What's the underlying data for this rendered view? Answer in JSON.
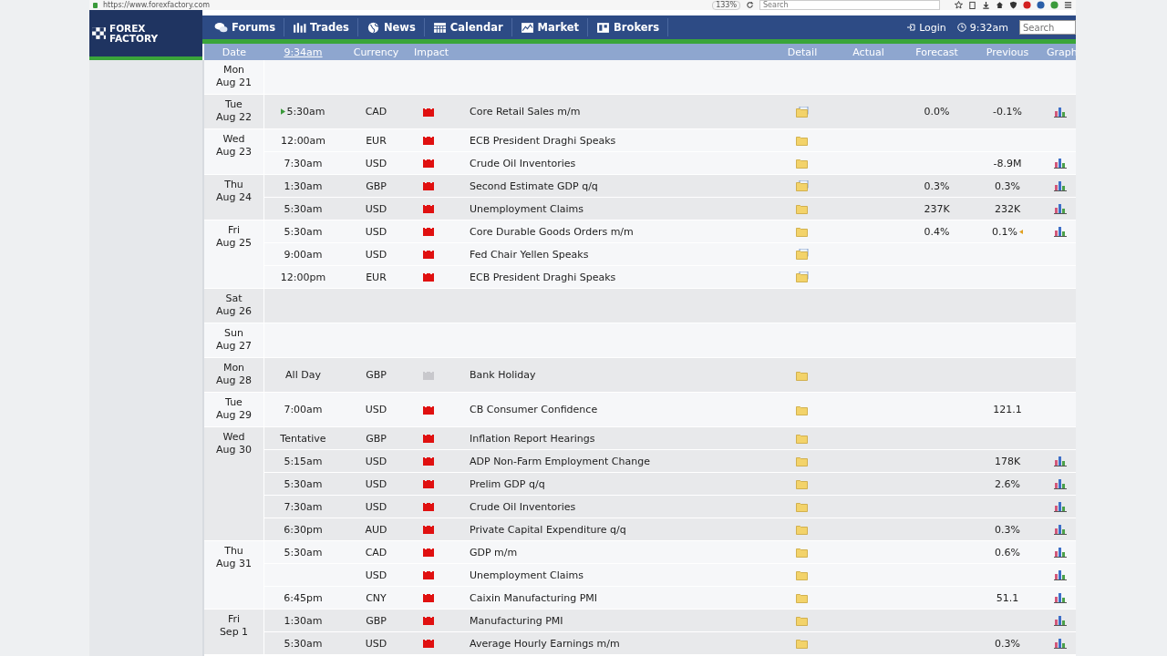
{
  "browser": {
    "url": "https://www.forexfactory.com",
    "zoom": "133%",
    "search_placeholder": "Search"
  },
  "site": {
    "logo": [
      "FOREX",
      "FACTORY"
    ],
    "nav": [
      {
        "label": "Forums",
        "kind": "chat"
      },
      {
        "label": "Trades",
        "kind": "bars"
      },
      {
        "label": "News",
        "kind": "globe"
      },
      {
        "label": "Calendar",
        "kind": "calendar"
      },
      {
        "label": "Market",
        "kind": "chart"
      },
      {
        "label": "Brokers",
        "kind": "building"
      }
    ],
    "login": "Login",
    "time": "9:32am",
    "search_placeholder": "Search"
  },
  "columns": {
    "date": "Date",
    "time": "9:34am",
    "currency": "Currency",
    "impact": "Impact",
    "detail": "Detail",
    "actual": "Actual",
    "forecast": "Forecast",
    "previous": "Previous",
    "graph": "Graph"
  },
  "days": [
    {
      "day": "Mon",
      "date": "Aug 21"
    },
    {
      "day": "Tue",
      "date": "Aug 22",
      "events": [
        {
          "time": "5:30am",
          "next": true,
          "currency": "CAD",
          "color": "#e01010",
          "title": "Core Retail Sales m/m",
          "has_document": true,
          "forecast": "0.0%",
          "previous": "-0.1%",
          "revised": false,
          "graph": true
        }
      ]
    },
    {
      "day": "Wed",
      "date": "Aug 23",
      "events": [
        {
          "time": "12:00am",
          "next": false,
          "currency": "EUR",
          "color": "#e01010",
          "title": "ECB President Draghi Speaks",
          "has_document": false,
          "revised": false,
          "graph": false
        },
        {
          "time": "7:30am",
          "next": false,
          "currency": "USD",
          "color": "#e01010",
          "title": "Crude Oil Inventories",
          "has_document": false,
          "previous": "-8.9M",
          "revised": false,
          "graph": true
        }
      ]
    },
    {
      "day": "Thu",
      "date": "Aug 24",
      "events": [
        {
          "time": "1:30am",
          "next": false,
          "currency": "GBP",
          "color": "#e01010",
          "title": "Second Estimate GDP q/q",
          "has_document": true,
          "forecast": "0.3%",
          "previous": "0.3%",
          "revised": false,
          "graph": true
        },
        {
          "time": "5:30am",
          "next": false,
          "currency": "USD",
          "color": "#e01010",
          "title": "Unemployment Claims",
          "has_document": false,
          "forecast": "237K",
          "previous": "232K",
          "revised": false,
          "graph": true
        }
      ]
    },
    {
      "day": "Fri",
      "date": "Aug 25",
      "events": [
        {
          "time": "5:30am",
          "next": false,
          "currency": "USD",
          "color": "#e01010",
          "title": "Core Durable Goods Orders m/m",
          "has_document": false,
          "forecast": "0.4%",
          "previous": "0.1%",
          "revised": true,
          "graph": true
        },
        {
          "time": "9:00am",
          "next": false,
          "currency": "USD",
          "color": "#e01010",
          "title": "Fed Chair Yellen Speaks",
          "has_document": true,
          "revised": false,
          "graph": false
        },
        {
          "time": "12:00pm",
          "next": false,
          "currency": "EUR",
          "color": "#e01010",
          "title": "ECB President Draghi Speaks",
          "has_document": true,
          "revised": false,
          "graph": false
        }
      ]
    },
    {
      "day": "Sat",
      "date": "Aug 26"
    },
    {
      "day": "Sun",
      "date": "Aug 27"
    },
    {
      "day": "Mon",
      "date": "Aug 28",
      "events": [
        {
          "time": "All Day",
          "next": false,
          "currency": "GBP",
          "color": "#c8c8cc",
          "title": "Bank Holiday",
          "has_document": false,
          "revised": false,
          "graph": false
        }
      ]
    },
    {
      "day": "Tue",
      "date": "Aug 29",
      "events": [
        {
          "time": "7:00am",
          "next": false,
          "currency": "USD",
          "color": "#e01010",
          "title": "CB Consumer Confidence",
          "has_document": false,
          "previous": "121.1",
          "revised": false,
          "graph": false
        }
      ]
    },
    {
      "day": "Wed",
      "date": "Aug 30",
      "events": [
        {
          "time": "Tentative",
          "next": false,
          "currency": "GBP",
          "color": "#e01010",
          "title": "Inflation Report Hearings",
          "has_document": false,
          "revised": false,
          "graph": false
        },
        {
          "time": "5:15am",
          "next": false,
          "currency": "USD",
          "color": "#e01010",
          "title": "ADP Non-Farm Employment Change",
          "has_document": false,
          "previous": "178K",
          "revised": false,
          "graph": true
        },
        {
          "time": "5:30am",
          "next": false,
          "currency": "USD",
          "color": "#e01010",
          "title": "Prelim GDP q/q",
          "has_document": false,
          "previous": "2.6%",
          "revised": false,
          "graph": true
        },
        {
          "time": "7:30am",
          "next": false,
          "currency": "USD",
          "color": "#e01010",
          "title": "Crude Oil Inventories",
          "has_document": false,
          "revised": false,
          "graph": true
        },
        {
          "time": "6:30pm",
          "next": false,
          "currency": "AUD",
          "color": "#e01010",
          "title": "Private Capital Expenditure q/q",
          "has_document": false,
          "previous": "0.3%",
          "revised": false,
          "graph": true
        }
      ]
    },
    {
      "day": "Thu",
      "date": "Aug 31",
      "events": [
        {
          "time": "5:30am",
          "next": false,
          "currency": "CAD",
          "color": "#e01010",
          "title": "GDP m/m",
          "has_document": false,
          "previous": "0.6%",
          "revised": false,
          "graph": true
        },
        {
          "next": false,
          "currency": "USD",
          "color": "#e01010",
          "title": "Unemployment Claims",
          "has_document": false,
          "revised": false,
          "graph": true
        },
        {
          "time": "6:45pm",
          "next": false,
          "currency": "CNY",
          "color": "#e01010",
          "title": "Caixin Manufacturing PMI",
          "has_document": false,
          "previous": "51.1",
          "revised": false,
          "graph": true
        }
      ]
    },
    {
      "day": "Fri",
      "date": "Sep 1",
      "events": [
        {
          "time": "1:30am",
          "next": false,
          "currency": "GBP",
          "color": "#e01010",
          "title": "Manufacturing PMI",
          "has_document": false,
          "revised": false,
          "graph": true
        },
        {
          "time": "5:30am",
          "next": false,
          "currency": "USD",
          "color": "#e01010",
          "title": "Average Hourly Earnings m/m",
          "has_document": false,
          "previous": "0.3%",
          "revised": false,
          "graph": true
        }
      ]
    }
  ]
}
